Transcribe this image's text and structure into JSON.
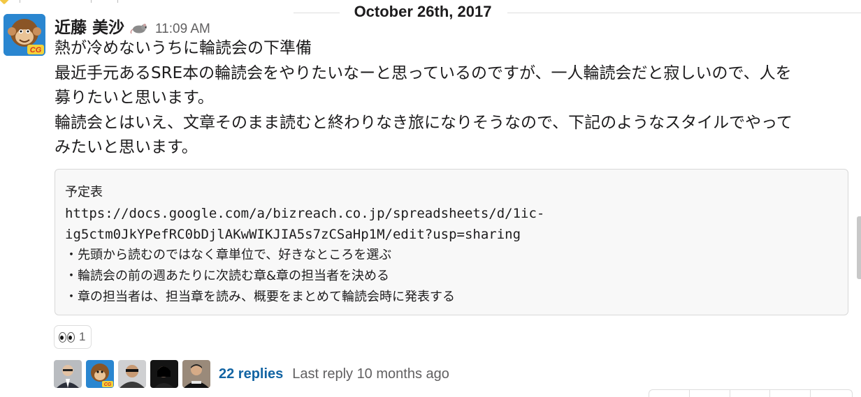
{
  "date_divider": {
    "label": "October 26th, 2017"
  },
  "message": {
    "sender": "近藤 美沙",
    "status_emoji": "rat",
    "timestamp": "11:09 AM",
    "lines": [
      "熱が冷めないうちに輪読会の下準備",
      "最近手元あるSRE本の輪読会をやりたいなーと思っているのですが、一人輪読会だと寂しいので、人を",
      "募りたいと思います。",
      "輪読会とはいえ、文章そのまま読むと終わりなき旅になりそうなので、下記のようなスタイルでやって",
      "みたいと思います。"
    ],
    "snippet": {
      "title": "予定表",
      "url_line1": "https://docs.google.com/a/bizreach.co.jp/spreadsheets/d/1ic-",
      "url_line2": "ig5ctm0JkYPefRC0bDjlAKwWIKJIA5s7zCSaHp1M/edit?usp=sharing",
      "bullets": [
        "・先頭から読むのではなく章単位で、好きなところを選ぶ",
        "・輪読会の前の週あたりに次読む章&章の担当者を決める",
        "・章の担当者は、担当章を読み、概要をまとめて輪読会時に発表する"
      ]
    },
    "reaction": {
      "emoji": "eyes",
      "count": "1"
    },
    "thread": {
      "reply_count_label": "22 replies",
      "last_reply_label": "Last reply 10 months ago",
      "reply_avatars": [
        "avatar-man-glasses",
        "avatar-monkey-cartoon",
        "avatar-man-sunglasses",
        "avatar-woman-dark",
        "avatar-man-black-shirt"
      ]
    }
  },
  "colors": {
    "link": "#1264a3",
    "meta_text": "#616061",
    "snippet_bg": "#f8f8f8",
    "divider": "#dddddd"
  }
}
